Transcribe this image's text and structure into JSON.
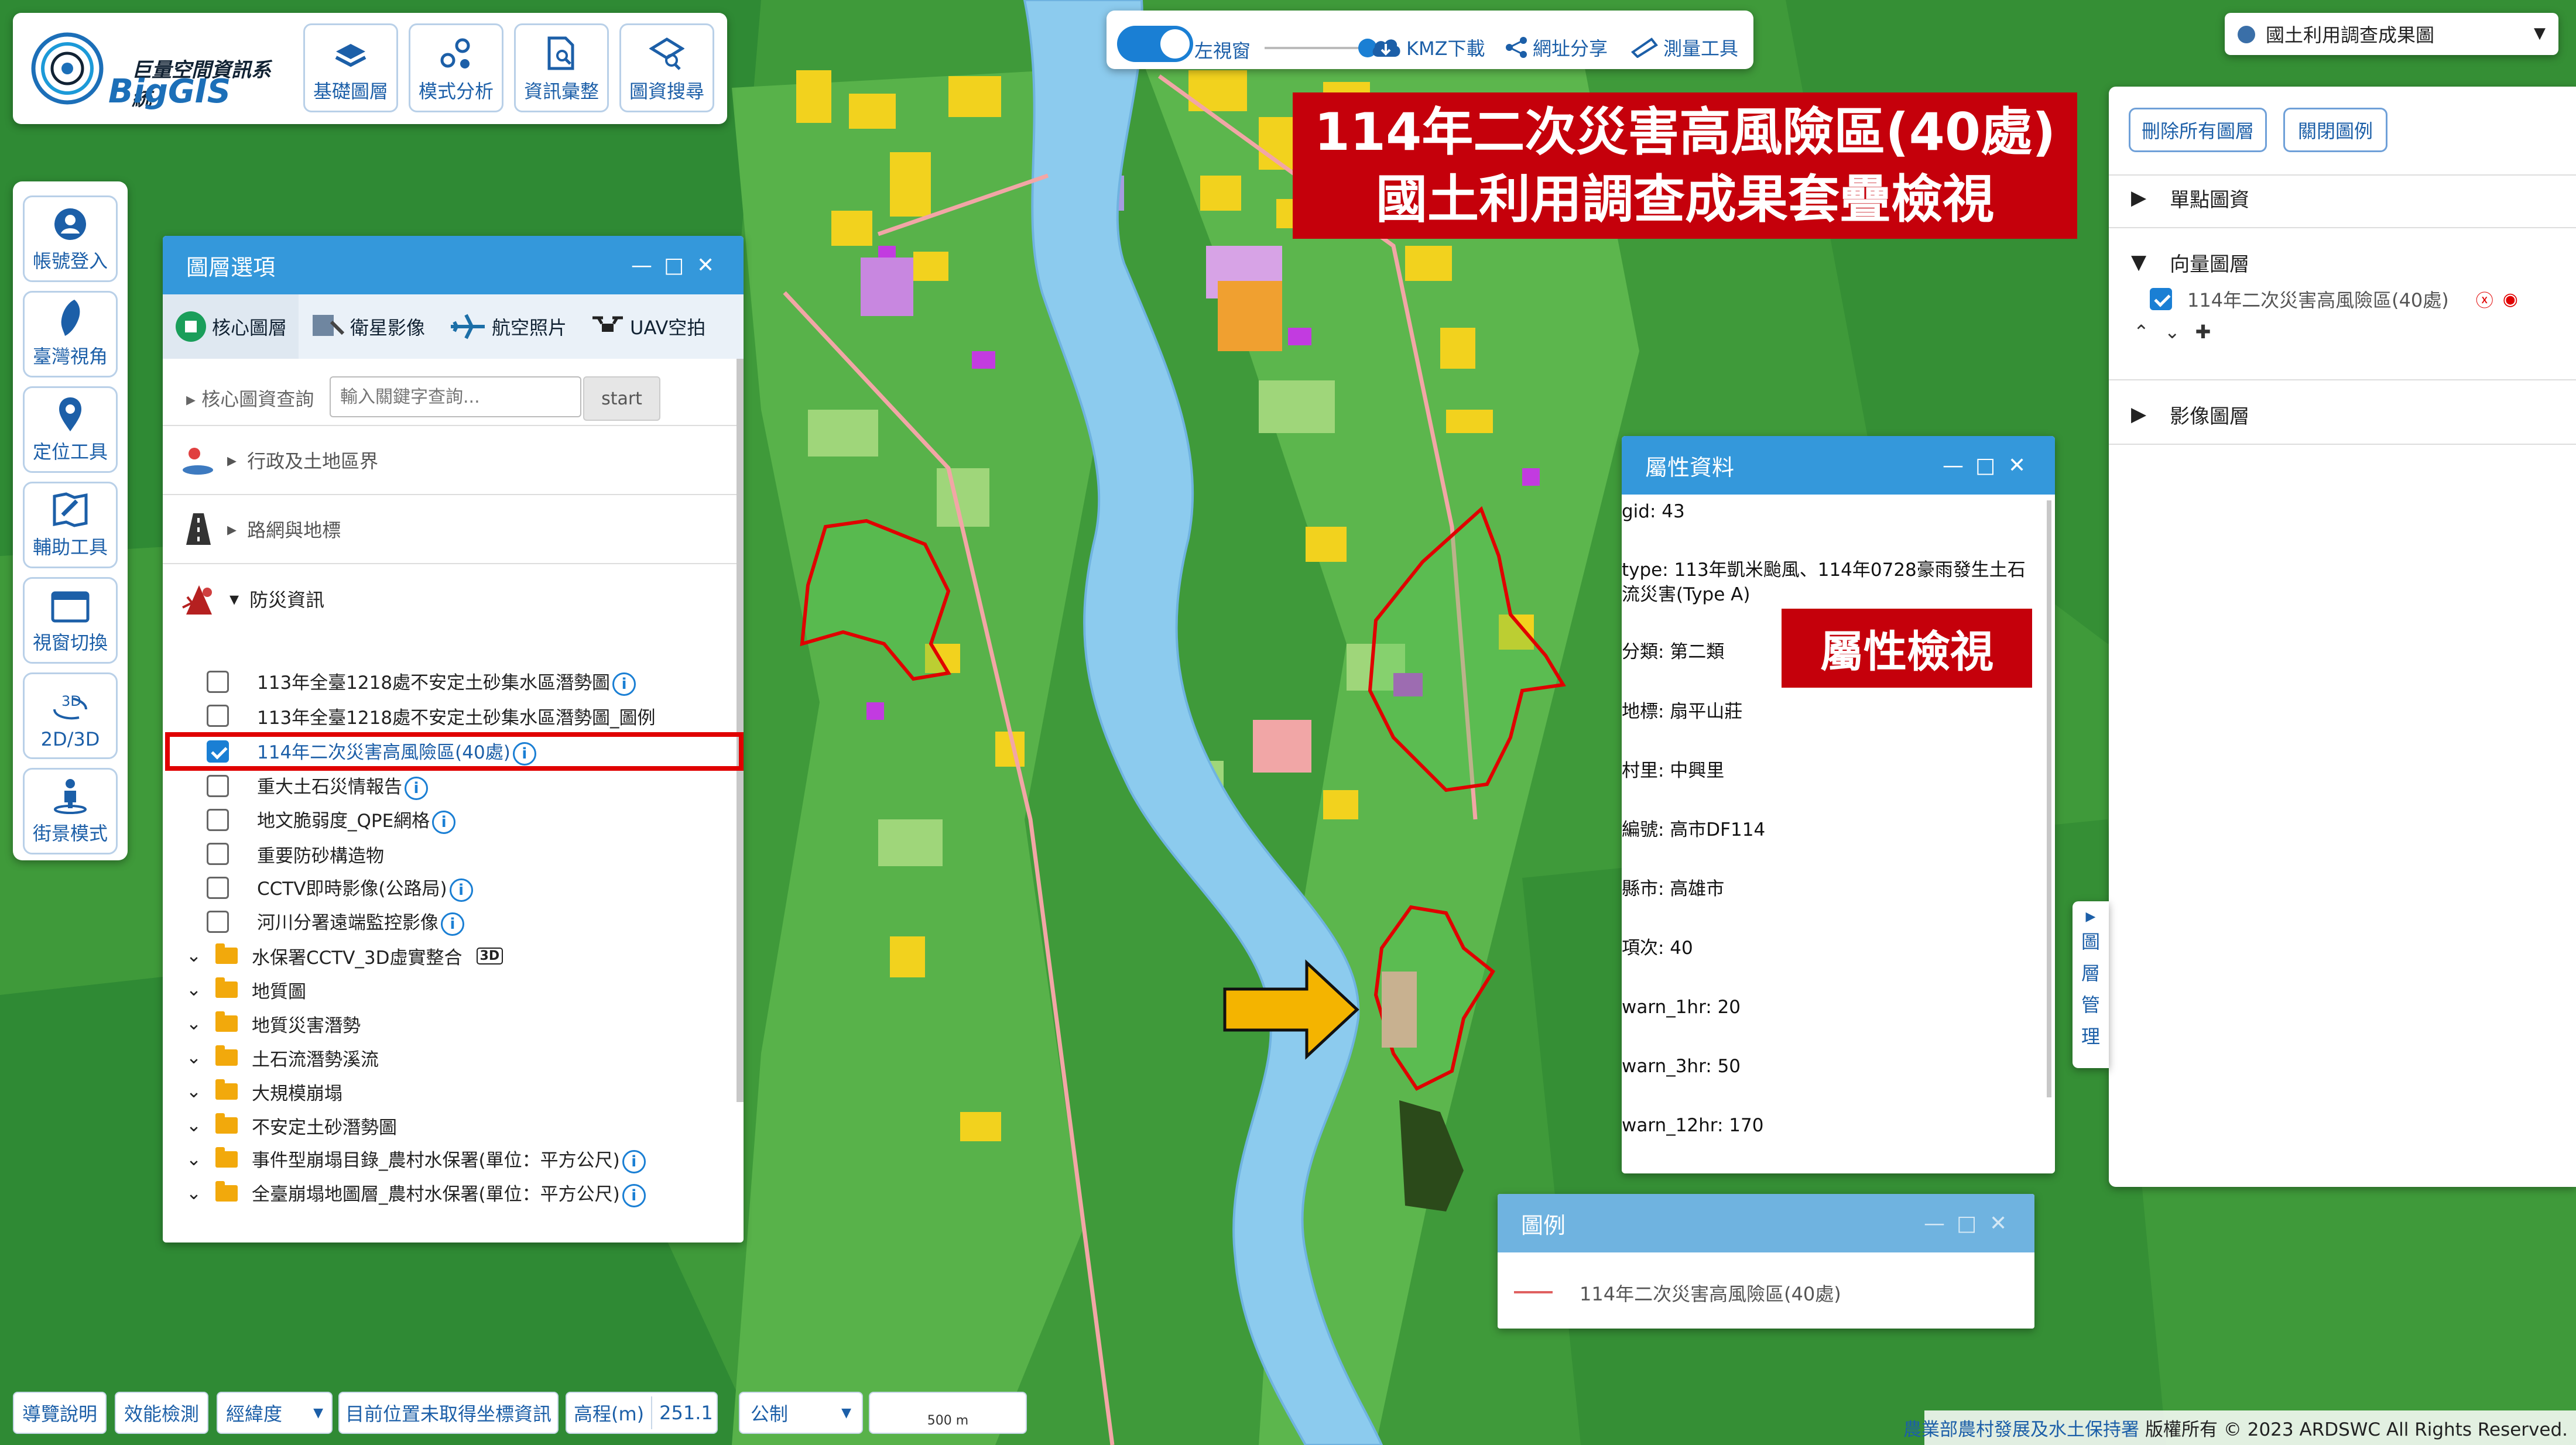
{
  "logo": {
    "subtitle": "巨量空間資訊系統",
    "name": "BigGIS"
  },
  "top_tools": [
    {
      "label": "基礎圖層",
      "icon": "layers-icon"
    },
    {
      "label": "模式分析",
      "icon": "analysis-icon"
    },
    {
      "label": "資訊彙整",
      "icon": "document-search-icon"
    },
    {
      "label": "圖資搜尋",
      "icon": "map-search-icon"
    }
  ],
  "side_tools": [
    {
      "label": "帳號登入",
      "icon": "user-icon"
    },
    {
      "label": "臺灣視角",
      "icon": "taiwan-icon"
    },
    {
      "label": "定位工具",
      "icon": "location-pin-icon"
    },
    {
      "label": "輔助工具",
      "icon": "tools-icon"
    },
    {
      "label": "視窗切換",
      "icon": "window-icon"
    },
    {
      "label": "2D/3D",
      "badge": "3D",
      "icon": "rotate-3d-icon"
    },
    {
      "label": "街景模式",
      "icon": "street-view-icon"
    }
  ],
  "center_toolbar": {
    "split_label": "左視窗",
    "kmz_label": "KMZ下載",
    "share_label": "網址分享",
    "measure_label": "測量工具"
  },
  "basemap_select": {
    "value": "國土利用調查成果圖"
  },
  "title_banner": {
    "line1": "114年二次災害高風險區(40處)",
    "line2": "國土利用調查成果套疊檢視"
  },
  "layer_manager": {
    "remove_all_label": "刪除所有圖層",
    "close_legend_label": "關閉圖例",
    "sections": {
      "point": "單點圖資",
      "vector": "向量圖層",
      "image": "影像圖層"
    },
    "vector_layer": "114年二次災害高風險區(40處)",
    "side_tab": [
      "圖",
      "層",
      "管",
      "理"
    ]
  },
  "layer_panel": {
    "title": "圖層選項",
    "tabs": [
      "核心圖層",
      "衛星影像",
      "航空照片",
      "UAV空拍"
    ],
    "search_label": "核心圖資查詢",
    "search_placeholder": "輸入關鍵字查詢...",
    "search_button": "start",
    "groups": [
      "行政及土地區界",
      "路網與地標",
      "防災資訊"
    ],
    "disaster_items": [
      {
        "label": "113年全臺1218處不安定土砂集水區潛勢圖",
        "checked": false,
        "info": true
      },
      {
        "label": "113年全臺1218處不安定土砂集水區潛勢圖_圖例",
        "checked": false,
        "info": false
      },
      {
        "label": "114年二次災害高風險區(40處)",
        "checked": true,
        "info": true
      },
      {
        "label": "重大土石災情報告",
        "checked": false,
        "info": true
      },
      {
        "label": "地文脆弱度_QPE網格",
        "checked": false,
        "info": true
      },
      {
        "label": "重要防砂構造物",
        "checked": false,
        "info": false
      },
      {
        "label": "CCTV即時影像(公路局)",
        "checked": false,
        "info": true
      },
      {
        "label": "河川分署遠端監控影像",
        "checked": false,
        "info": true
      }
    ],
    "folders": [
      {
        "label": "水保署CCTV_3D虛實整合",
        "badge": "3D"
      },
      {
        "label": "地質圖"
      },
      {
        "label": "地質災害潛勢"
      },
      {
        "label": "土石流潛勢溪流"
      },
      {
        "label": "大規模崩塌"
      },
      {
        "label": "不安定土砂潛勢圖"
      },
      {
        "label": "事件型崩塌目錄_農村水保署(單位：平方公尺)",
        "info": true
      },
      {
        "label": "全臺崩塌地圖層_農村水保署(單位：平方公尺)",
        "info": true
      }
    ]
  },
  "attribute_panel": {
    "title": "屬性資料",
    "rows": [
      "gid: 43",
      "type: 113年凱米颱風、114年0728豪雨發生土石流災害(Type A)",
      "分類: 第二類",
      "地標: 扇平山莊",
      "村里: 中興里",
      "編號: 高市DF114",
      "縣市: 高雄市",
      "項次: 40",
      "warn_1hr: 20",
      "warn_3hr: 50",
      "warn_12hr: 170"
    ],
    "badge": "屬性檢視"
  },
  "legend_panel": {
    "title": "圖例",
    "item": "114年二次災害高風險區(40處)",
    "color": "#e06060"
  },
  "bottom_bar": {
    "guide": "導覽說明",
    "performance": "效能檢測",
    "coord_system": "經緯度",
    "coord_status": "目前位置未取得坐標資訊",
    "elevation_label": "高程(m)",
    "elevation_value": "251.1",
    "unit_system": "公制",
    "scale": "500 m"
  },
  "copyright": {
    "agency": "農業部農村發展及水土保持署",
    "rights": "版權所有 © 2023 ARDSWC All Rights Reserved."
  },
  "colors": {
    "map_green": "#3f9a3a",
    "river": "#8ccbee",
    "primary": "#1a7fd4",
    "banner_red": "#c5000b",
    "highlight_red": "#e00000",
    "arrow_yellow": "#f4b400"
  }
}
